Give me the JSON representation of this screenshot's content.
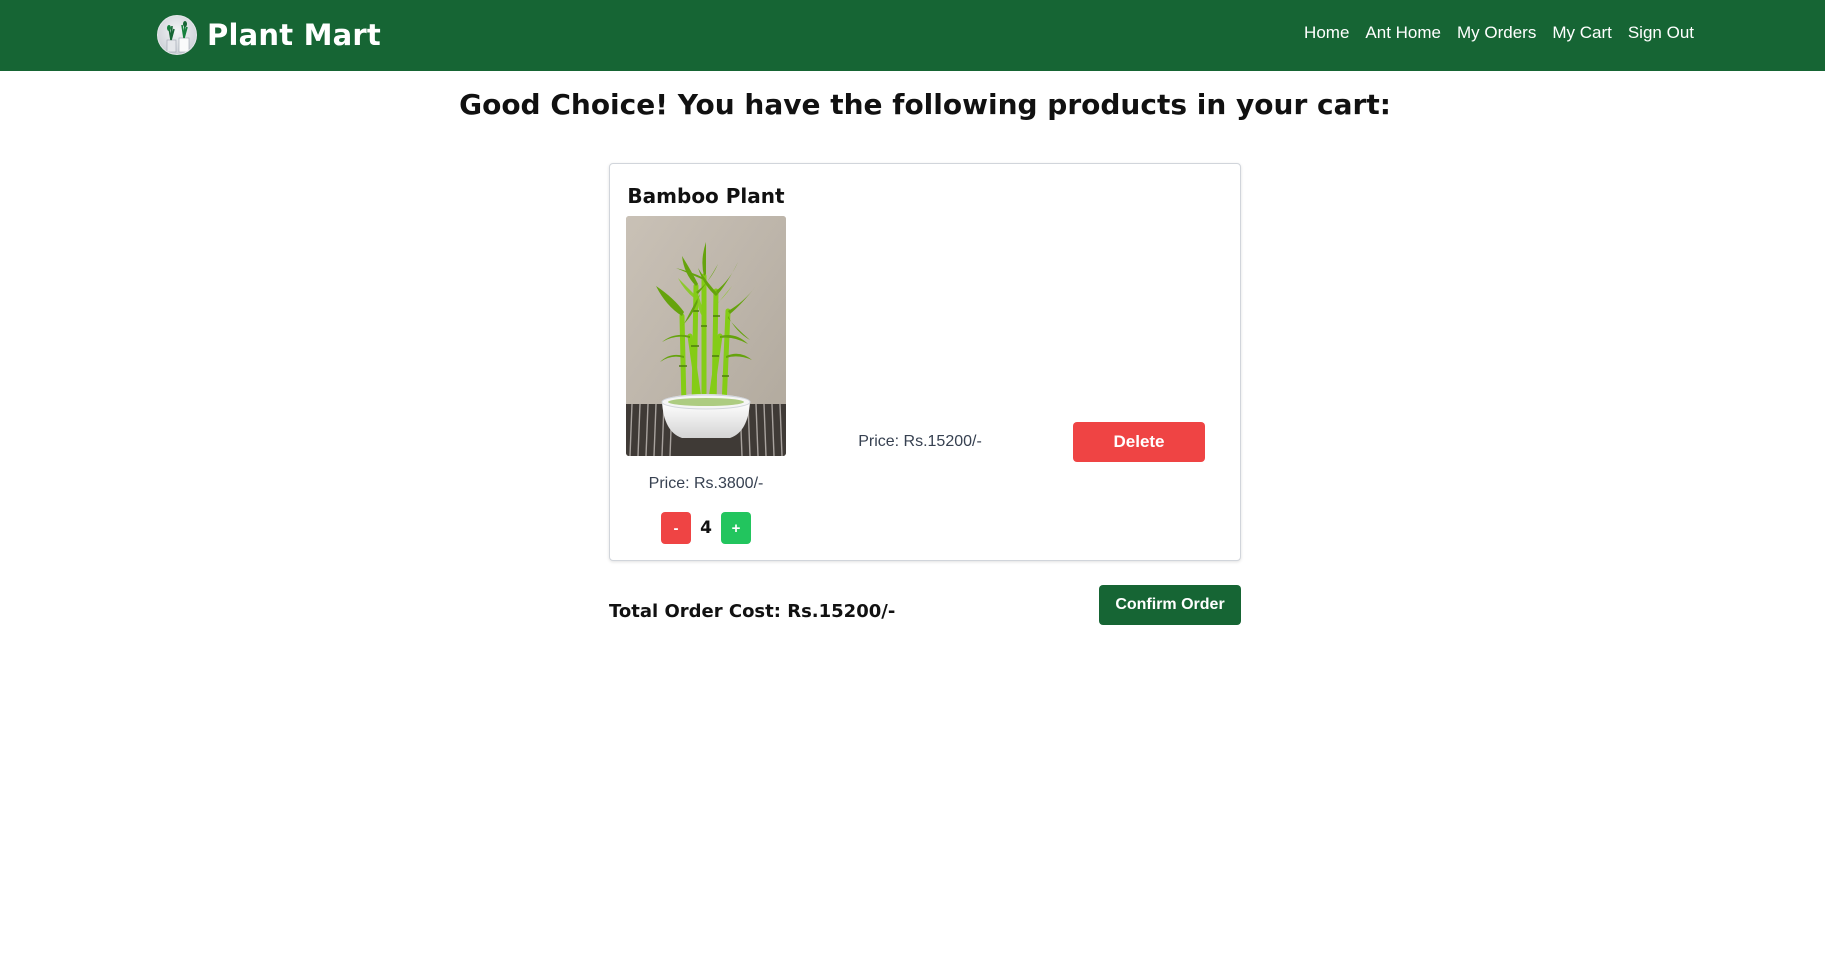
{
  "header": {
    "brand_name": "Plant Mart",
    "logo_icon": "potted-plant-logo",
    "nav_links": [
      "Home",
      "Ant Home",
      "My Orders",
      "My Cart",
      "Sign Out"
    ],
    "background_color": "#166534"
  },
  "main": {
    "title": "Good Choice! You have the following products in your cart:"
  },
  "cart": {
    "items": [
      {
        "name": "Bamboo Plant",
        "image": "bamboo-plant-photo",
        "unit_price": "Price: Rs.3800/-",
        "quantity": "4",
        "decrement_label": "-",
        "increment_label": "+",
        "line_price": "Price: Rs.15200/-",
        "delete_label": "Delete"
      }
    ]
  },
  "summary": {
    "total_cost": "Total Order Cost: Rs.15200/-",
    "confirm_label": "Confirm Order"
  },
  "colors": {
    "primary_green": "#166534",
    "danger_red": "#ef4444",
    "success_green": "#22c55e"
  }
}
